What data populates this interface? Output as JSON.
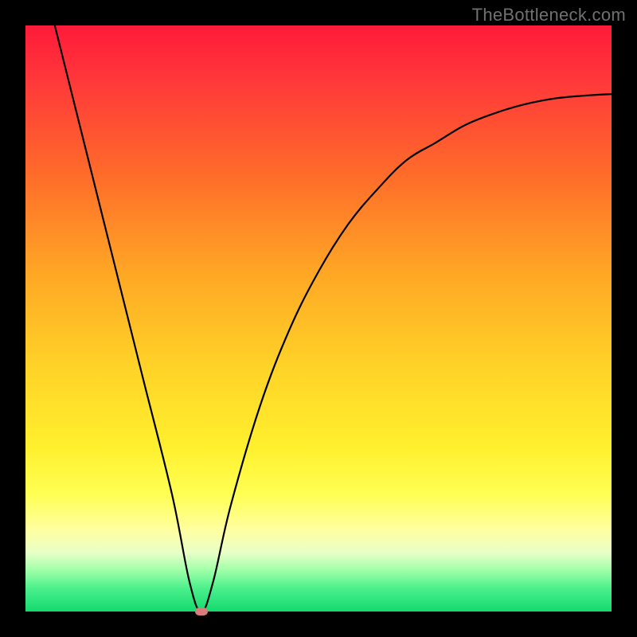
{
  "watermark": "TheBottleneck.com",
  "chart_data": {
    "type": "line",
    "title": "",
    "xlabel": "",
    "ylabel": "",
    "xlim": [
      0,
      100
    ],
    "ylim": [
      0,
      100
    ],
    "x": [
      5,
      10,
      15,
      20,
      25,
      28,
      30,
      32,
      35,
      40,
      45,
      50,
      55,
      60,
      65,
      70,
      75,
      80,
      85,
      90,
      95,
      100
    ],
    "values": [
      100,
      80,
      60,
      40,
      20,
      5,
      0,
      5,
      18,
      35,
      48,
      58,
      66,
      72,
      77,
      80,
      83,
      85,
      86.5,
      87.5,
      88,
      88.3
    ],
    "background_gradient": {
      "top": "#ff1a3a",
      "mid": "#ffd227",
      "bottom": "#14d96e"
    },
    "marker": {
      "x": 30,
      "y": 0,
      "color": "#d87c7c"
    }
  }
}
